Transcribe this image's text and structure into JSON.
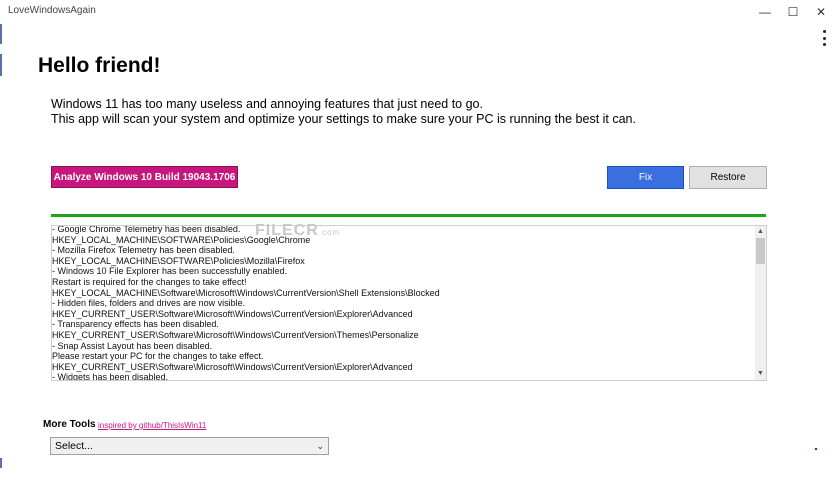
{
  "window": {
    "title": "LoveWindowsAgain",
    "minimize_glyph": "—",
    "maximize_glyph": "☐",
    "close_glyph": "✕"
  },
  "header": {
    "title": "Hello friend!",
    "intro_line1": "Windows 11 has too many useless and annoying features that just need to go.",
    "intro_line2": "This app will scan your system and optimize your settings to make sure your PC is running the best it can."
  },
  "actions": {
    "analyze_label": "Analyze Windows 10 Build 19043.1706",
    "fix_label": "Fix",
    "restore_label": "Restore"
  },
  "progress": {
    "value": 1.0,
    "color": "#1aa51a"
  },
  "watermark": {
    "text": "FILECR",
    "suffix": ".com"
  },
  "log": {
    "lines": [
      "- Google Chrome Telemetry has been disabled.",
      "HKEY_LOCAL_MACHINE\\SOFTWARE\\Policies\\Google\\Chrome",
      "- Mozilla Firefox Telemetry has been disabled.",
      "HKEY_LOCAL_MACHINE\\SOFTWARE\\Policies\\Mozilla\\Firefox",
      "- Windows 10 File Explorer has been successfully enabled.",
      "Restart is required for the changes to take effect!",
      "HKEY_LOCAL_MACHINE\\Software\\Microsoft\\Windows\\CurrentVersion\\Shell Extensions\\Blocked",
      "- Hidden files, folders and drives are now visible.",
      "HKEY_CURRENT_USER\\Software\\Microsoft\\Windows\\CurrentVersion\\Explorer\\Advanced",
      "- Transparency effects has been disabled.",
      "HKEY_CURRENT_USER\\Software\\Microsoft\\Windows\\CurrentVersion\\Themes\\Personalize",
      "- Snap Assist Layout has been disabled.",
      "Please restart your PC for the changes to take effect.",
      "HKEY_CURRENT_USER\\Software\\Microsoft\\Windows\\CurrentVersion\\Explorer\\Advanced",
      "- Widgets has been disabled."
    ]
  },
  "footer": {
    "more_tools_label": "More Tools",
    "inspired_link": "inspired by github/ThisIsWin11",
    "select_value": "Select..."
  },
  "colors": {
    "accent_magenta": "#c8167f",
    "fix_blue": "#3a6fe0",
    "progress_green": "#1aa51a"
  }
}
